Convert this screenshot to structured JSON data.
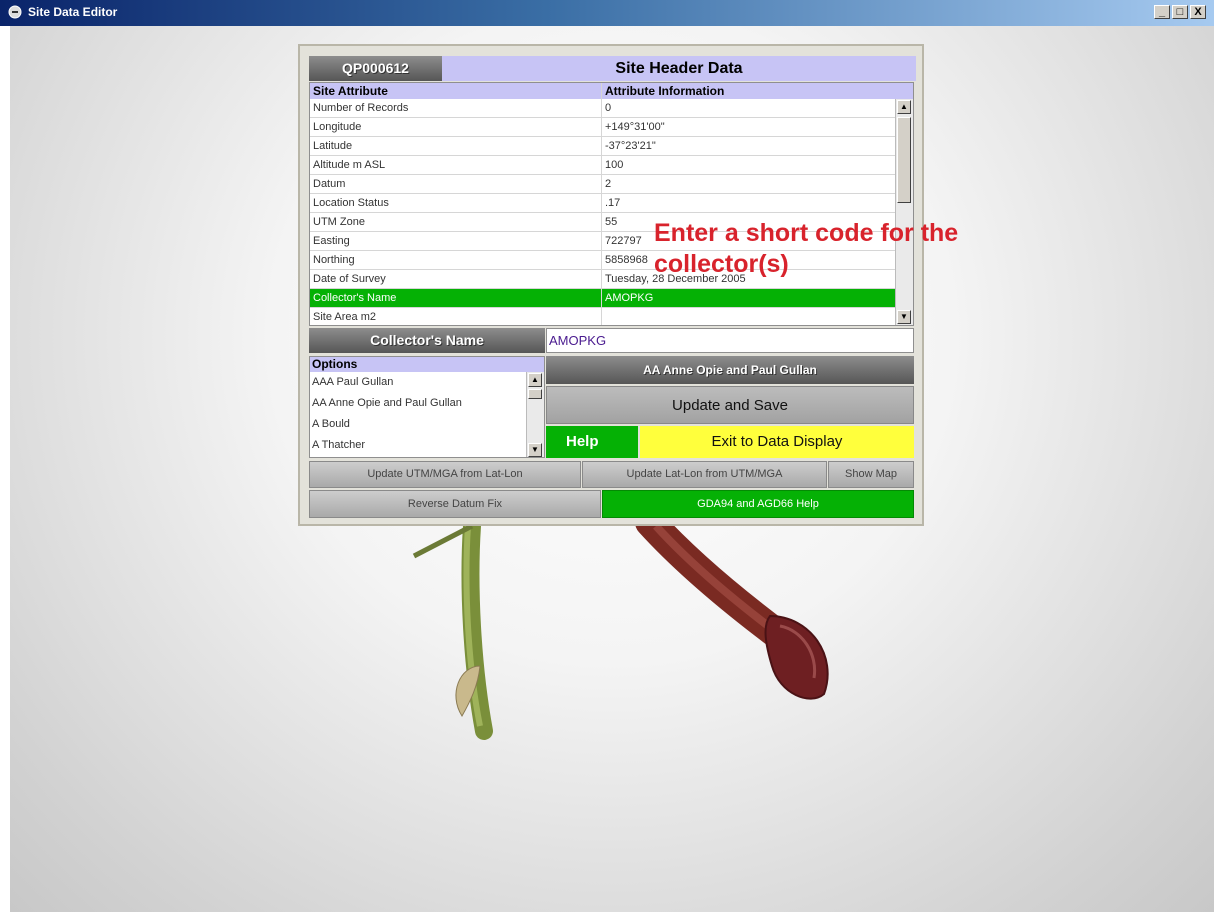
{
  "window": {
    "title": "Site Data Editor",
    "controls": [
      "_",
      "□",
      "X"
    ]
  },
  "header": {
    "site_id": "QP000612",
    "title": "Site Header Data"
  },
  "table": {
    "columns": [
      "Site Attribute",
      "Attribute Information"
    ],
    "rows": [
      {
        "attr": "Number of Records",
        "info": "0"
      },
      {
        "attr": "Longitude",
        "info": "+149°31'00\""
      },
      {
        "attr": "Latitude",
        "info": "-37°23'21\""
      },
      {
        "attr": "Altitude m ASL",
        "info": "100"
      },
      {
        "attr": "Datum",
        "info": "2"
      },
      {
        "attr": "Location Status",
        "info": ".17"
      },
      {
        "attr": "UTM Zone",
        "info": "55"
      },
      {
        "attr": "Easting",
        "info": "722797"
      },
      {
        "attr": "Northing",
        "info": "5858968"
      },
      {
        "attr": "Date of Survey",
        "info": "Tuesday, 28 December 2005"
      },
      {
        "attr": "Collector's Name",
        "info": "AMOPKG"
      },
      {
        "attr": "Site Area m2",
        "info": ""
      }
    ],
    "selected_index": 10
  },
  "collector": {
    "label": "Collector's Name",
    "value": "AMOPKG"
  },
  "options": {
    "header": "Options",
    "items": [
      "AAA Paul Gullan",
      "AA Anne Opie and Paul Gullan",
      "A Bould",
      "A Thatcher"
    ],
    "selected_display": "AA Anne Opie and Paul Gullan"
  },
  "buttons": {
    "update_save": "Update and Save",
    "help": "Help",
    "exit": "Exit to Data Display",
    "utm_from_latlon": "Update UTM/MGA from Lat-Lon",
    "latlon_from_utm": "Update Lat-Lon from UTM/MGA",
    "show_map": "Show Map",
    "reverse_datum": "Reverse Datum Fix",
    "gda_help": "GDA94 and AGD66 Help"
  },
  "callout": {
    "line1": "Enter a short code for the",
    "line2": "collector(s)"
  },
  "colors": {
    "accent_purple": "#c7c4f5",
    "green": "#05b105",
    "yellow": "#ffff3c",
    "callout_red": "#d8232c"
  }
}
